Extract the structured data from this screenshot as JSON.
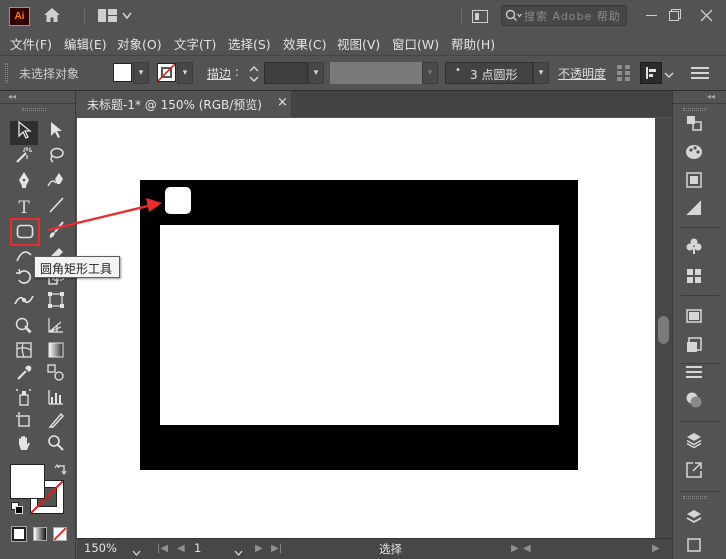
{
  "app": {
    "logo_text": "Ai"
  },
  "titlebar": {
    "search_placeholder": "搜索 Adobe 帮助",
    "icons": [
      "home-icon",
      "workspace-switcher-icon",
      "arrange-icon",
      "search-icon"
    ]
  },
  "menu": [
    "文件(F)",
    "编辑(E)",
    "对象(O)",
    "文字(T)",
    "选择(S)",
    "效果(C)",
    "视图(V)",
    "窗口(W)",
    "帮助(H)"
  ],
  "control": {
    "selection_status": "未选择对象",
    "stroke_label": "描边",
    "stroke_colon": ":",
    "brush_value": "3 点圆形",
    "brush_dot": "•",
    "opacity_label": "不透明度"
  },
  "document": {
    "tab_title": "未标题-1* @ 150% (RGB/预览)",
    "close_glyph": "×"
  },
  "tooltip": {
    "text": "圆角矩形工具"
  },
  "status": {
    "zoom": "150%",
    "artboard": "1",
    "tool": "选择"
  },
  "colors": {
    "accent_red": "#e82b2b",
    "panel": "#535353",
    "canvas": "#ffffff",
    "artwork": "#000000"
  }
}
